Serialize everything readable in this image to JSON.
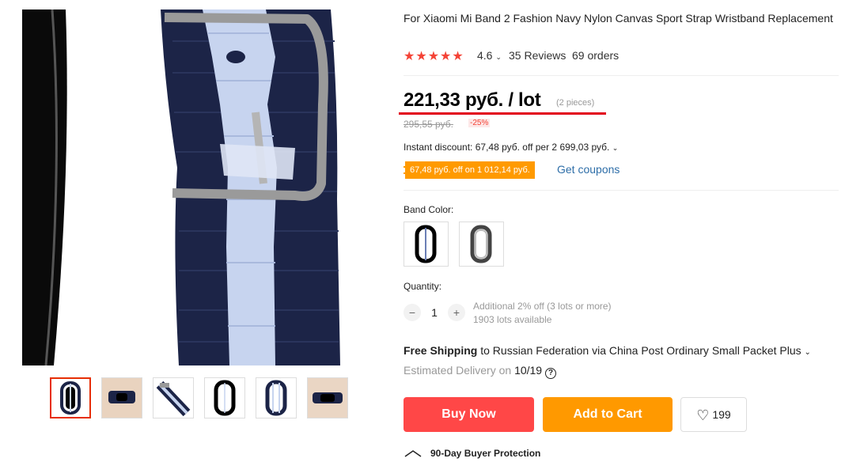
{
  "product": {
    "title": "For Xiaomi Mi Band 2 Fashion Navy Nylon Canvas Sport Strap Wristband Replacement",
    "rating": "4.6",
    "reviews": "35 Reviews",
    "orders": "69 orders",
    "stars": "★★★★★"
  },
  "pricing": {
    "price": "221,33 руб. / lot",
    "unit": "(2 pieces)",
    "old_price": "295,55 руб.",
    "discount": "-25%",
    "instant_discount": "Instant discount: 67,48 руб. off per 2 699,03 руб.",
    "coupon_badge": "67,48 руб. off on 1 012,14 руб.",
    "get_coupons": "Get coupons"
  },
  "options": {
    "band_color_label": "Band Color:",
    "quantity_label": "Quantity:",
    "quantity": "1",
    "minus": "−",
    "plus": "+",
    "additional": "Additional 2% off (3 lots or more)",
    "available": "1903 lots available"
  },
  "shipping": {
    "free_label": "Free Shipping",
    "destination": "to Russian Federation via China Post Ordinary Small Packet Plus",
    "estimated_prefix": "Estimated Delivery on",
    "estimated_date": "10/19"
  },
  "actions": {
    "buy_now": "Buy Now",
    "add_to_cart": "Add to Cart",
    "wishlist_count": "199"
  },
  "protection": {
    "label": "90-Day Buyer Protection"
  },
  "colors": {
    "accent_red": "#ff4747",
    "accent_orange": "#ff9900",
    "star": "#f44336",
    "navy": "#1c2447"
  }
}
